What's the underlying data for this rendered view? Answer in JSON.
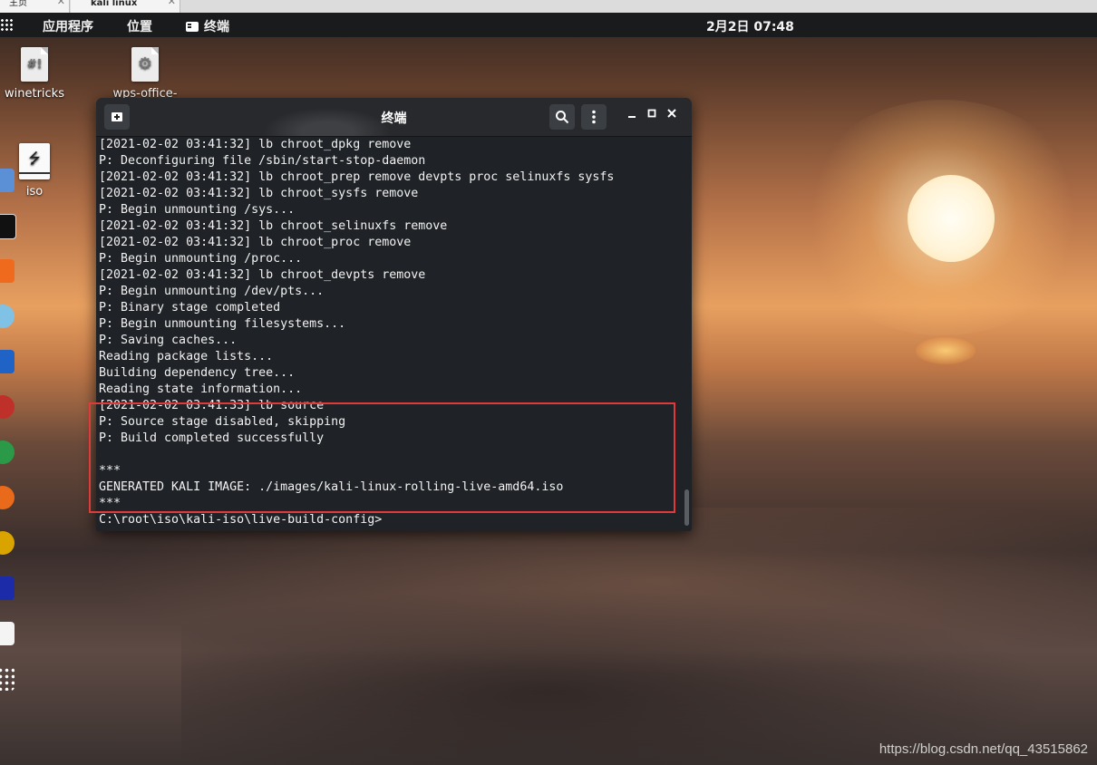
{
  "host_tabs": [
    {
      "label": "主页"
    },
    {
      "label": "kali linux"
    }
  ],
  "panel": {
    "applications": "应用程序",
    "places": "位置",
    "terminal_app": "终端",
    "clock": "2月2日 07:48"
  },
  "desktop": {
    "icons": [
      {
        "label": "winetricks",
        "glyph": "#!"
      },
      {
        "label": "wps-office-",
        "glyph": "⚙"
      },
      {
        "label": "iso",
        "glyph": "⭍"
      }
    ]
  },
  "terminal": {
    "title": "终端",
    "lines": [
      "[2021-02-02 03:41:32] lb chroot_dpkg remove",
      "P: Deconfiguring file /sbin/start-stop-daemon",
      "[2021-02-02 03:41:32] lb chroot_prep remove devpts proc selinuxfs sysfs",
      "[2021-02-02 03:41:32] lb chroot_sysfs remove",
      "P: Begin unmounting /sys...",
      "[2021-02-02 03:41:32] lb chroot_selinuxfs remove",
      "[2021-02-02 03:41:32] lb chroot_proc remove",
      "P: Begin unmounting /proc...",
      "[2021-02-02 03:41:32] lb chroot_devpts remove",
      "P: Begin unmounting /dev/pts...",
      "P: Binary stage completed",
      "P: Begin unmounting filesystems...",
      "P: Saving caches...",
      "Reading package lists...",
      "Building dependency tree...",
      "Reading state information...",
      "[2021-02-02 03:41:33] lb source",
      "P: Source stage disabled, skipping",
      "P: Build completed successfully",
      "",
      "***",
      "GENERATED KALI IMAGE: ./images/kali-linux-rolling-live-amd64.iso",
      "***",
      "C:\\root\\iso\\kali-iso\\live-build-config>"
    ]
  },
  "watermark": "https://blog.csdn.net/qq_43515862",
  "colors": {
    "highlight": "#e03a3a",
    "terminal_bg": "#1f2226",
    "panel_bg": "#1a1b1d"
  }
}
